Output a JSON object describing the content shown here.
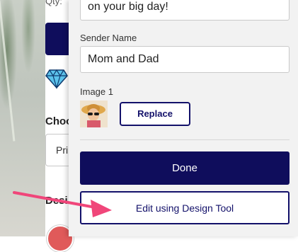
{
  "underlying_page": {
    "qty_label": "Qty:",
    "choose_label": "Choo",
    "select_value": "Pri",
    "design_label": "Desi"
  },
  "panel": {
    "message_value": "on your big day!",
    "sender_label": "Sender Name",
    "sender_value": "Mom and Dad",
    "image_label": "Image 1",
    "replace_label": "Replace",
    "done_label": "Done",
    "edit_label": "Edit using Design Tool"
  },
  "colors": {
    "accent_navy": "#0f0d5c",
    "panel_bg": "#f2f2f2",
    "arrow_pink": "#f0467a"
  },
  "icons": {
    "diamond": "diamond-icon",
    "annotation": "pointing-arrow"
  }
}
